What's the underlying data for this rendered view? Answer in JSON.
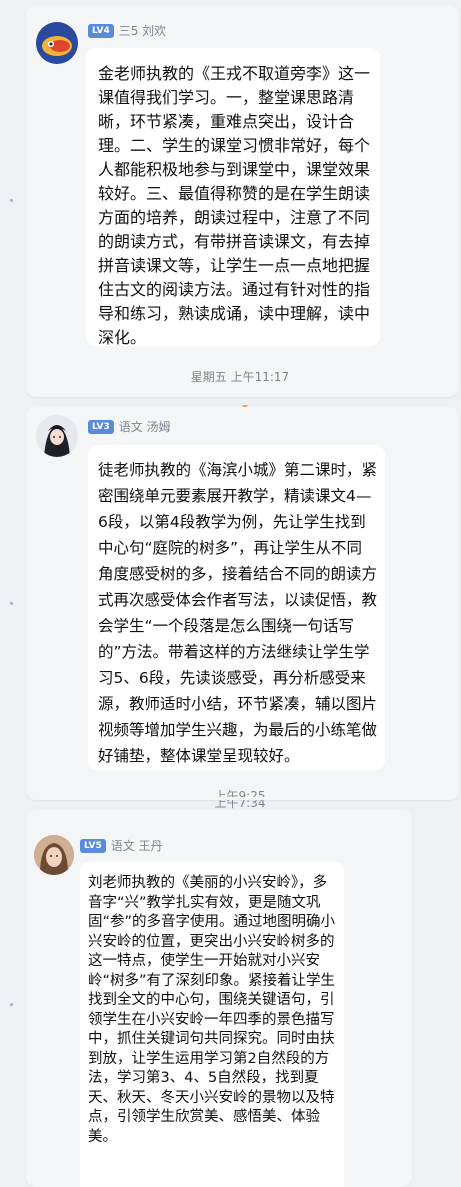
{
  "messages": [
    {
      "level": "LV4",
      "author": "三5 刘欢",
      "text": "金老师执教的《王戎不取道旁李》这一课值得我们学习。一，整堂课思路清晰，环节紧凑，重难点突出，设计合理。二、学生的课堂习惯非常好，每个人都能积极地参与到课堂中，课堂效果较好。三、最值得称赞的是在学生朗读方面的培养，朗读过程中，注意了不同的朗读方式，有带拼音读课文，有去掉拼音读课文等，让学生一点一点地把握住古文的阅读方法。通过有针对性的指导和练习，熟读成诵，读中理解，读中深化。",
      "time": "星期五 上午11:17"
    },
    {
      "level": "LV3",
      "author": "语文 汤姆",
      "text": "徒老师执教的《海滨小城》第二课时，紧密围绕单元要素展开教学，精读课文4—6段，以第4段教学为例，先让学生找到中心句“庭院的树多”，再让学生从不同角度感受树的多，接着结合不同的朗读方式再次感受体会作者写法，以读促悟，教会学生“一个段落是怎么围绕一句话写的”方法。带着这样的方法继续让学生学习5、6段，先读谈感受，再分析感受来源，教师适时小结，环节紧凑，辅以图片视频等增加学生兴趣，为最后的小练笔做好铺垫，整体课堂呈现较好。",
      "time": "上午9:25",
      "time_overlap": "上午7:34"
    },
    {
      "level": "LV5",
      "author": "语文 王丹",
      "text": "刘老师执教的《美丽的小兴安岭》，多音字“兴”教学扎实有效，更是随文巩固“参”的多音字使用。通过地图明确小兴安岭的位置，更突出小兴安岭树多的这一特点，使学生一开始就对小兴安岭“树多”有了深刻印象。紧接着让学生找到全文的中心句，围绕关键语句，引领学生在小兴安岭一年四季的景色描写中，抓住关键词句共同探究。同时由扶到放，让学生运用学习第2自然段的方法，学习第3、4、5自然段，找到夏天、秋天、冬天小兴安岭的景物以及特点，引领学生欣赏美、感悟美、体验美。"
    }
  ],
  "colors": {
    "badge": "#5a8bd8",
    "bubble": "#ffffff",
    "page": "#eef0f4",
    "marker": "#f0a040"
  }
}
